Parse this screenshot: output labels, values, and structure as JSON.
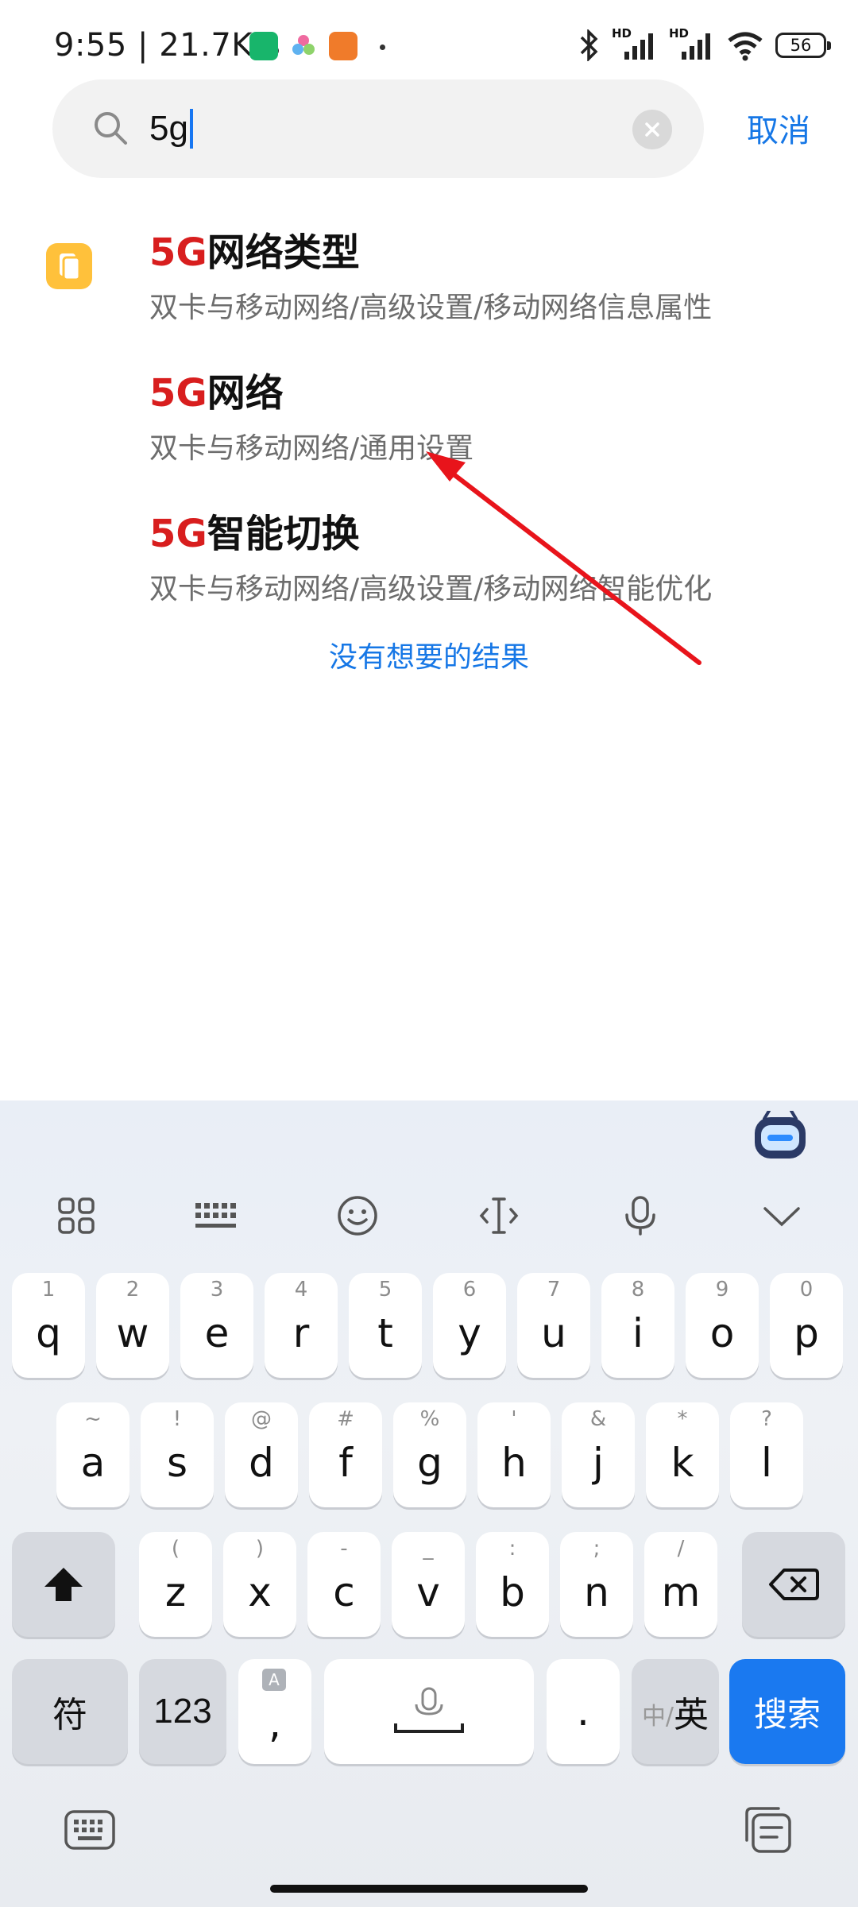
{
  "status_bar": {
    "time": "9:55 | 21.7K/s",
    "battery": "56",
    "signal_1_label": "HD",
    "signal_2_label": "HD"
  },
  "search": {
    "query": "5g",
    "cancel_label": "取消"
  },
  "results": [
    {
      "highlight": "5G",
      "title_rest": "网络类型",
      "path": "双卡与移动网络/高级设置/移动网络信息属性"
    },
    {
      "highlight": "5G",
      "title_rest": "网络",
      "path": "双卡与移动网络/通用设置"
    },
    {
      "highlight": "5G",
      "title_rest": "智能切换",
      "path": "双卡与移动网络/高级设置/移动网络智能优化"
    }
  ],
  "no_result_link": "没有想要的结果",
  "keyboard": {
    "row1": [
      {
        "sub": "1",
        "main": "q"
      },
      {
        "sub": "2",
        "main": "w"
      },
      {
        "sub": "3",
        "main": "e"
      },
      {
        "sub": "4",
        "main": "r"
      },
      {
        "sub": "5",
        "main": "t"
      },
      {
        "sub": "6",
        "main": "y"
      },
      {
        "sub": "7",
        "main": "u"
      },
      {
        "sub": "8",
        "main": "i"
      },
      {
        "sub": "9",
        "main": "o"
      },
      {
        "sub": "0",
        "main": "p"
      }
    ],
    "row2": [
      {
        "sub": "~",
        "main": "a"
      },
      {
        "sub": "!",
        "main": "s"
      },
      {
        "sub": "@",
        "main": "d"
      },
      {
        "sub": "#",
        "main": "f"
      },
      {
        "sub": "%",
        "main": "g"
      },
      {
        "sub": "'",
        "main": "h"
      },
      {
        "sub": "&",
        "main": "j"
      },
      {
        "sub": "*",
        "main": "k"
      },
      {
        "sub": "?",
        "main": "l"
      }
    ],
    "row3": [
      {
        "sub": "(",
        "main": "z"
      },
      {
        "sub": ")",
        "main": "x"
      },
      {
        "sub": "-",
        "main": "c"
      },
      {
        "sub": "_",
        "main": "v"
      },
      {
        "sub": ":",
        "main": "b"
      },
      {
        "sub": ";",
        "main": "n"
      },
      {
        "sub": "/",
        "main": "m"
      }
    ],
    "symbol_key": "符",
    "num_key": "123",
    "comma_key": ",",
    "comma_badge": "A",
    "period_key": ".",
    "lang_key_dim": "中/",
    "lang_key": "英",
    "search_key": "搜索"
  },
  "colors": {
    "highlight": "#d81e1e",
    "accent": "#1677e6",
    "search_key": "#1a79f0",
    "annotation_arrow": "#e8141b"
  }
}
